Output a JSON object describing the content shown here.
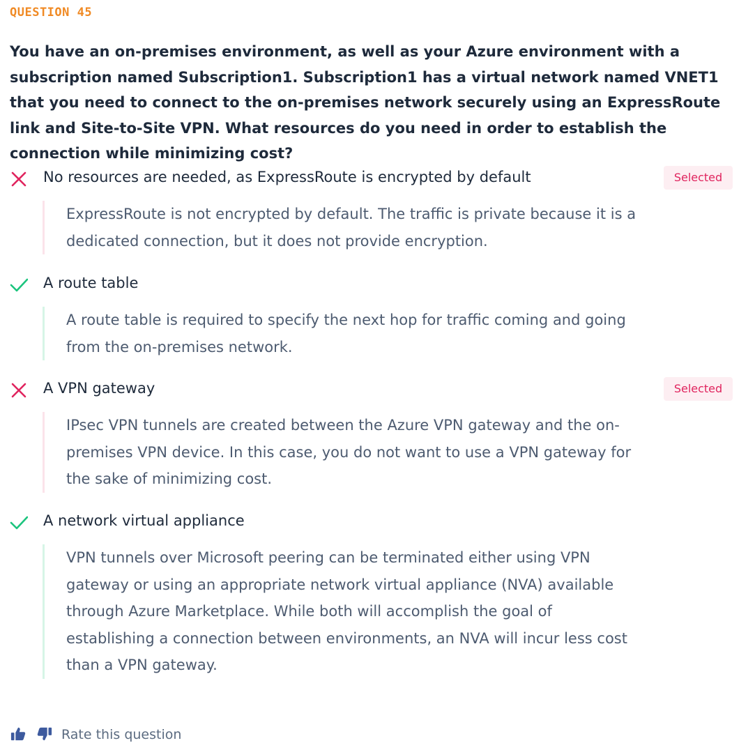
{
  "question": {
    "number_label": "QUESTION 45",
    "text": "You have an on-premises environment, as well as your Azure environment with a subscription named Subscription1. Subscription1 has a virtual network named VNET1 that you need to connect to the on-premises network securely using an ExpressRoute link and Site-to-Site VPN. What resources do you need in order to establish the connection while minimizing cost?"
  },
  "options": [
    {
      "label": "No resources are needed, as ExpressRoute is encrypted by default",
      "status": "incorrect",
      "icon": "cross-icon",
      "selected_label": "Selected",
      "explanation": "ExpressRoute is not encrypted by default. The traffic is private because it is a dedicated connection, but it does not provide encryption."
    },
    {
      "label": "A route table",
      "status": "correct",
      "icon": "check-icon",
      "explanation": "A route table is required to specify the next hop for traffic coming and going from the on-premises network."
    },
    {
      "label": "A VPN gateway",
      "status": "incorrect",
      "icon": "cross-icon",
      "selected_label": "Selected",
      "explanation": "IPsec VPN tunnels are created between the Azure VPN gateway and the on-premises VPN device. In this case, you do not want to use a VPN gateway for the sake of minimizing cost."
    },
    {
      "label": "A network virtual appliance",
      "status": "correct",
      "icon": "check-icon",
      "explanation": "VPN tunnels over Microsoft peering can be terminated either using VPN gateway or using an appropriate network virtual appliance (NVA) available through Azure Marketplace. While both will accomplish the goal of establishing a connection between environments, an NVA will incur less cost than a VPN gateway."
    }
  ],
  "rating": {
    "label": "Rate this question",
    "thumbs_up_icon": "thumbs-up-icon",
    "thumbs_down_icon": "thumbs-down-icon"
  },
  "colors": {
    "question_number": "#f08a24",
    "incorrect": "#e0245e",
    "correct": "#1bc47d",
    "selected_badge_bg": "#fdeef2",
    "text": "#1e2a3b",
    "explanation_text": "#4d5b70"
  }
}
